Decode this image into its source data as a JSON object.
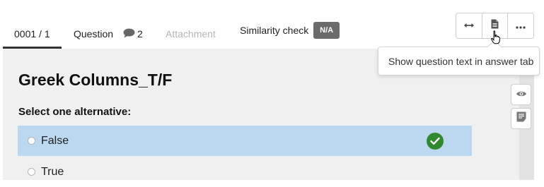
{
  "tabs": {
    "item_number": "0001 / 1",
    "question_label": "Question",
    "comment_count": "2",
    "attachment_label": "Attachment",
    "similarity_label": "Similarity check",
    "similarity_badge": "N/A"
  },
  "toolbar": {
    "buttons": [
      "expand-horizontal-icon",
      "document-icon",
      "more-icon"
    ]
  },
  "tooltip": {
    "text": "Show question text in answer tab"
  },
  "question": {
    "title": "Greek Columns_T/F",
    "prompt": "Select one alternative:",
    "options": [
      {
        "label": "False",
        "selected": true,
        "correct": true
      },
      {
        "label": "True",
        "selected": false,
        "correct": false
      }
    ]
  },
  "side_tools": [
    "eye-icon",
    "notes-icon"
  ],
  "colors": {
    "selected_bg": "#bcd7f0",
    "correct": "#2f8a2b",
    "badge_bg": "#6b6b6b",
    "content_bg": "#f0f0f0"
  }
}
